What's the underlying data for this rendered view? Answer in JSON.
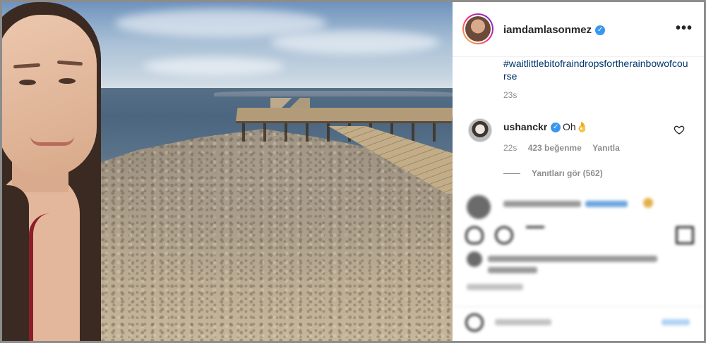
{
  "post": {
    "author": "iamdamlasonmez",
    "more_icon": "more-horizontal-icon",
    "caption_hashtag": "#waitlittlebitofraindropsfortherainbowofcourse",
    "caption_time": "23s"
  },
  "comment": {
    "user": "ushanckr",
    "text": "Oh👌",
    "time": "22s",
    "likes": "423 beğenme",
    "reply": "Yanıtla",
    "view_replies": "Yanıtları gör (562)"
  },
  "colors": {
    "link": "#00376b",
    "verified": "#3897f0",
    "secondary_text": "#8e8e8e"
  }
}
